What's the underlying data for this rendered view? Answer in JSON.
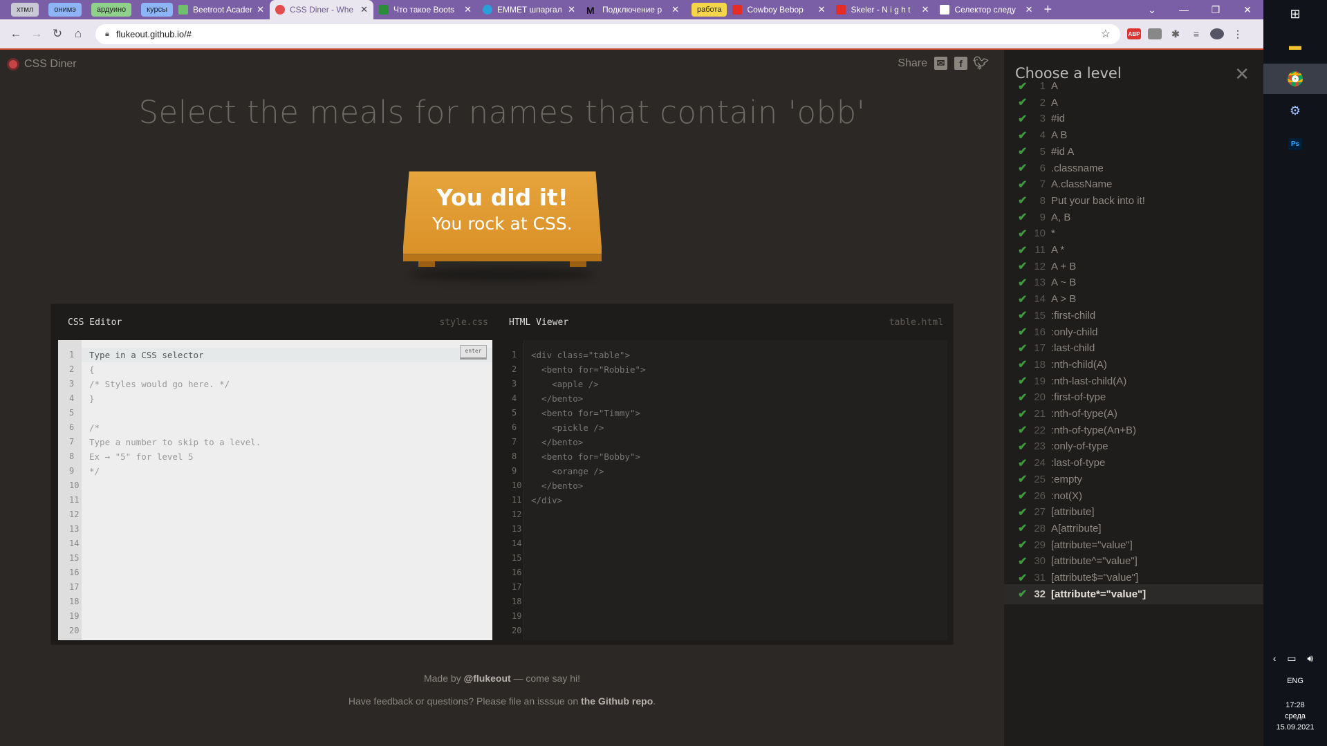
{
  "browser": {
    "tab_groups": [
      {
        "label": "хтмл",
        "color": "#c9c9d6"
      },
      {
        "label": "онимэ",
        "color": "#8db4f5"
      },
      {
        "label": "ардуино",
        "color": "#8fd08a"
      },
      {
        "label": "курсы",
        "color": "#8db4f5"
      },
      {
        "label": "работа",
        "color": "#f5d64b"
      }
    ],
    "tabs": [
      {
        "title": "Beetroot Acaden",
        "favicon_color": "#6fbf6f"
      },
      {
        "title": "CSS Diner - Whe",
        "favicon_color": "#e34c4c"
      },
      {
        "title": "Что такое Boots",
        "favicon_color": "#2c8c3c"
      },
      {
        "title": "EMMET шпаргал",
        "favicon_color": "#2a9fd8"
      },
      {
        "title": "Подключение р",
        "favicon_color": "#333333",
        "favicon_text": "M"
      },
      {
        "title": "Cowboy Bebop",
        "favicon_color": "#e52d27"
      },
      {
        "title": "Skeler - N i g h t",
        "favicon_color": "#e52d27"
      },
      {
        "title": "Селектор следу",
        "favicon_color": "#ffffff"
      }
    ],
    "url": "flukeout.github.io/#",
    "extensions": [
      "ABP",
      "ext2",
      "puzzle",
      "media",
      "avatar"
    ]
  },
  "page": {
    "logo_text": "CSS Diner",
    "share_label": "Share",
    "instruction": "Select the meals for names that contain 'obb'",
    "win_line1": "You did it!",
    "win_line2": "You rock at CSS.",
    "css_editor": {
      "title": "CSS Editor",
      "file": "style.css",
      "input_placeholder": "Type in a CSS selector",
      "enter_label": "enter",
      "lines": [
        "{",
        "/* Styles would go here. */",
        "}",
        "",
        "/*",
        "Type a number to skip to a level.",
        "Ex → \"5\" for level 5",
        "*/",
        "",
        "",
        "",
        "",
        "",
        "",
        "",
        "",
        "",
        "",
        ""
      ]
    },
    "html_viewer": {
      "title": "HTML Viewer",
      "file": "table.html",
      "lines": [
        "<div class=\"table\">",
        "  <bento for=\"Robbie\">",
        "    <apple />",
        "  </bento>",
        "  <bento for=\"Timmy\">",
        "    <pickle />",
        "  </bento>",
        "  <bento for=\"Bobby\">",
        "    <orange />",
        "  </bento>",
        "</div>",
        "",
        "",
        "",
        "",
        "",
        "",
        "",
        "",
        ""
      ]
    },
    "line_numbers": [
      "1",
      "2",
      "3",
      "4",
      "5",
      "6",
      "7",
      "8",
      "9",
      "10",
      "11",
      "12",
      "13",
      "14",
      "15",
      "16",
      "17",
      "18",
      "19",
      "20"
    ],
    "footer": {
      "made_by_prefix": "Made by ",
      "made_by_handle": "@flukeout",
      "made_by_suffix": " — come say hi!",
      "feedback_prefix": "Have feedback or questions? Please file an isssue on ",
      "feedback_link": "the Github repo",
      "feedback_suffix": "."
    }
  },
  "levels": {
    "title": "Choose a level",
    "current": 32,
    "items": [
      {
        "n": "1",
        "name": "A"
      },
      {
        "n": "2",
        "name": "A"
      },
      {
        "n": "3",
        "name": "#id"
      },
      {
        "n": "4",
        "name": "A  B"
      },
      {
        "n": "5",
        "name": "#id  A"
      },
      {
        "n": "6",
        "name": ".classname"
      },
      {
        "n": "7",
        "name": "A.className"
      },
      {
        "n": "8",
        "name": "Put your back into it!"
      },
      {
        "n": "9",
        "name": "A, B"
      },
      {
        "n": "10",
        "name": "*"
      },
      {
        "n": "11",
        "name": "A *"
      },
      {
        "n": "12",
        "name": "A + B"
      },
      {
        "n": "13",
        "name": "A ~ B"
      },
      {
        "n": "14",
        "name": "A > B"
      },
      {
        "n": "15",
        "name": ":first-child"
      },
      {
        "n": "16",
        "name": ":only-child"
      },
      {
        "n": "17",
        "name": ":last-child"
      },
      {
        "n": "18",
        "name": ":nth-child(A)"
      },
      {
        "n": "19",
        "name": ":nth-last-child(A)"
      },
      {
        "n": "20",
        "name": ":first-of-type"
      },
      {
        "n": "21",
        "name": ":nth-of-type(A)"
      },
      {
        "n": "22",
        "name": ":nth-of-type(An+B)"
      },
      {
        "n": "23",
        "name": ":only-of-type"
      },
      {
        "n": "24",
        "name": ":last-of-type"
      },
      {
        "n": "25",
        "name": ":empty"
      },
      {
        "n": "26",
        "name": ":not(X)"
      },
      {
        "n": "27",
        "name": "[attribute]"
      },
      {
        "n": "28",
        "name": "A[attribute]"
      },
      {
        "n": "29",
        "name": "[attribute=\"value\"]"
      },
      {
        "n": "30",
        "name": "[attribute^=\"value\"]"
      },
      {
        "n": "31",
        "name": "[attribute$=\"value\"]"
      },
      {
        "n": "32",
        "name": "[attribute*=\"value\"]"
      }
    ]
  },
  "taskbar": {
    "language": "ENG",
    "time": "17:28",
    "day": "среда",
    "date": "15.09.2021",
    "pinned": [
      "windows-start",
      "file-explorer",
      "chrome",
      "steam",
      "photoshop"
    ]
  }
}
